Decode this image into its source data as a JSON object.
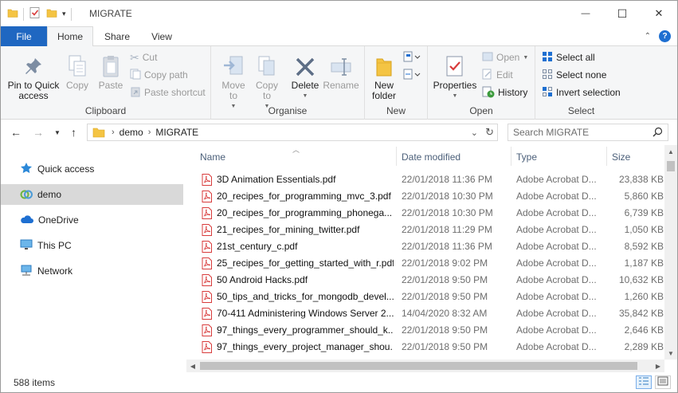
{
  "window": {
    "title": "MIGRATE",
    "controls": {
      "minimize": "—",
      "maximize": "☐",
      "close": "✕"
    }
  },
  "ribbon_tabs": {
    "file": "File",
    "home": "Home",
    "share": "Share",
    "view": "View"
  },
  "ribbon": {
    "clipboard": {
      "label": "Clipboard",
      "pin_to_quick_access": "Pin to Quick access",
      "copy": "Copy",
      "paste": "Paste",
      "cut": "Cut",
      "copy_path": "Copy path",
      "paste_shortcut": "Paste shortcut"
    },
    "organise": {
      "label": "Organise",
      "move_to": "Move to",
      "copy_to": "Copy to",
      "delete": "Delete",
      "rename": "Rename"
    },
    "new": {
      "label": "New",
      "new_folder": "New folder"
    },
    "open": {
      "label": "Open",
      "properties": "Properties",
      "open": "Open",
      "edit": "Edit",
      "history": "History"
    },
    "select": {
      "label": "Select",
      "select_all": "Select all",
      "select_none": "Select none",
      "invert_selection": "Invert selection"
    }
  },
  "address": {
    "crumbs": [
      "demo",
      "MIGRATE"
    ],
    "search_placeholder": "Search MIGRATE"
  },
  "nav_pane": {
    "items": [
      {
        "label": "Quick access",
        "icon": "star-icon"
      },
      {
        "label": "demo",
        "icon": "user-folder-icon",
        "selected": true
      },
      {
        "label": "OneDrive",
        "icon": "cloud-icon"
      },
      {
        "label": "This PC",
        "icon": "monitor-icon"
      },
      {
        "label": "Network",
        "icon": "network-icon"
      }
    ]
  },
  "file_list": {
    "columns": {
      "name": "Name",
      "date": "Date modified",
      "type": "Type",
      "size": "Size"
    },
    "rows": [
      {
        "name": "3D Animation Essentials.pdf",
        "date": "22/01/2018 11:36 PM",
        "type": "Adobe Acrobat D...",
        "size": "23,838 KB"
      },
      {
        "name": "20_recipes_for_programming_mvc_3.pdf",
        "date": "22/01/2018 10:30 PM",
        "type": "Adobe Acrobat D...",
        "size": "5,860 KB"
      },
      {
        "name": "20_recipes_for_programming_phonega...",
        "date": "22/01/2018 10:30 PM",
        "type": "Adobe Acrobat D...",
        "size": "6,739 KB"
      },
      {
        "name": "21_recipes_for_mining_twitter.pdf",
        "date": "22/01/2018 11:29 PM",
        "type": "Adobe Acrobat D...",
        "size": "1,050 KB"
      },
      {
        "name": "21st_century_c.pdf",
        "date": "22/01/2018 11:36 PM",
        "type": "Adobe Acrobat D...",
        "size": "8,592 KB"
      },
      {
        "name": "25_recipes_for_getting_started_with_r.pdf",
        "date": "22/01/2018 9:02 PM",
        "type": "Adobe Acrobat D...",
        "size": "1,187 KB"
      },
      {
        "name": "50 Android Hacks.pdf",
        "date": "22/01/2018 9:50 PM",
        "type": "Adobe Acrobat D...",
        "size": "10,632 KB"
      },
      {
        "name": "50_tips_and_tricks_for_mongodb_devel...",
        "date": "22/01/2018 9:50 PM",
        "type": "Adobe Acrobat D...",
        "size": "1,260 KB"
      },
      {
        "name": "70-411 Administering Windows Server 2...",
        "date": "14/04/2020 8:32 AM",
        "type": "Adobe Acrobat D...",
        "size": "35,842 KB"
      },
      {
        "name": "97_things_every_programmer_should_k...",
        "date": "22/01/2018 9:50 PM",
        "type": "Adobe Acrobat D...",
        "size": "2,646 KB"
      },
      {
        "name": "97_things_every_project_manager_shou...",
        "date": "22/01/2018 9:50 PM",
        "type": "Adobe Acrobat D...",
        "size": "2,289 KB"
      }
    ]
  },
  "status": {
    "item_count": "588 items"
  },
  "colors": {
    "file_tab_blue": "#1f67c1",
    "selected_nav": "#d9d9d9",
    "column_header_text": "#4c607a",
    "pdf_red": "#d83b3b"
  }
}
